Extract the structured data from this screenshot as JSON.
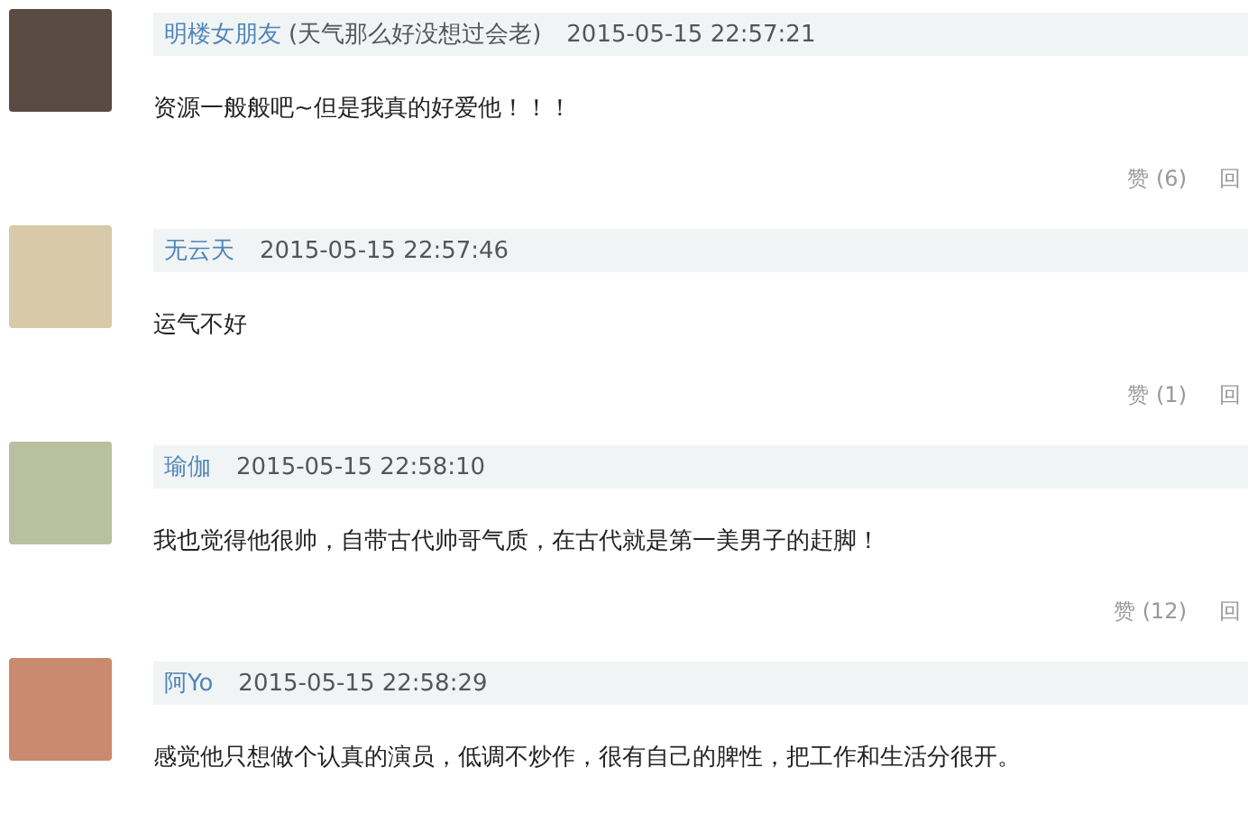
{
  "comments": [
    {
      "name": "明楼女朋友",
      "name_note": "(天气那么好没想过会老)",
      "time": "2015-05-15 22:57:21",
      "text": "资源一般般吧~但是我真的好爱他！！！",
      "likes": "赞 (6)",
      "reply": "回"
    },
    {
      "name": "无云天",
      "time": "2015-05-15 22:57:46",
      "text": "运气不好",
      "likes": "赞 (1)",
      "reply": "回"
    },
    {
      "name": "瑜伽",
      "time": "2015-05-15 22:58:10",
      "text": "我也觉得他很帅，自带古代帅哥气质，在古代就是第一美男子的赶脚！",
      "likes": "赞 (12)",
      "reply": "回"
    },
    {
      "name": "阿Yo",
      "time": "2015-05-15 22:58:29",
      "text": "感觉他只想做个认真的演员，低调不炒作，很有自己的脾性，把工作和生活分很开。"
    }
  ]
}
